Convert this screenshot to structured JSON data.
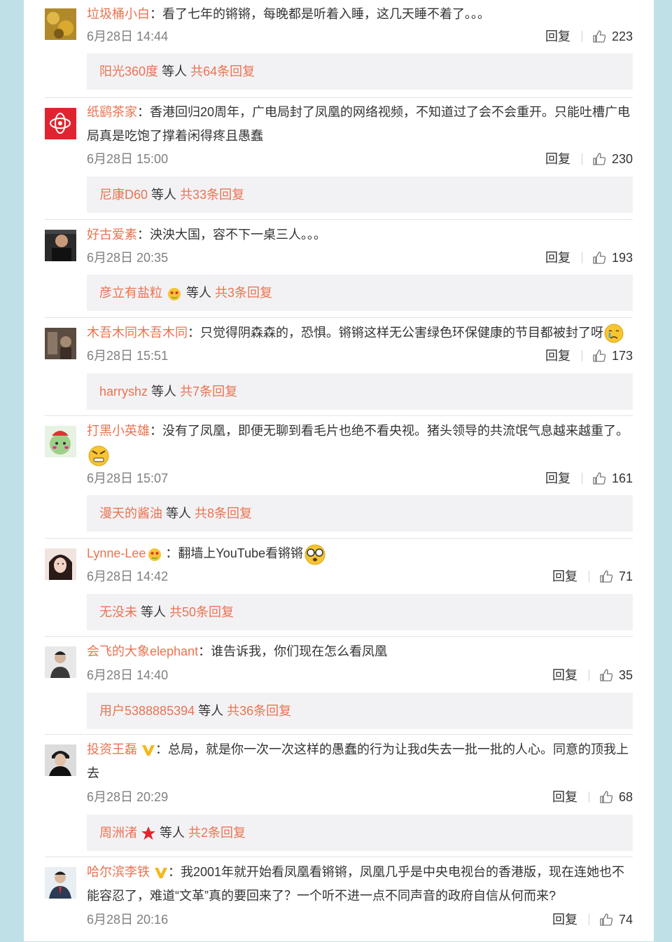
{
  "common": {
    "reply_label": "回复",
    "more_suffix": "等人",
    "colon": "："
  },
  "comments": [
    {
      "user": "垃圾桶小白",
      "text": "看了七年的锵锵，每晚都是听着入睡，这几天睡不着了。。。",
      "time": "6月28日 14:44",
      "likes": "223",
      "reply_user": "阳光360度",
      "reply_count": "共64条回复"
    },
    {
      "user": "纸鹞茶家",
      "text": "香港回归20周年，广电局封了凤凰的网络视频，不知道过了会不会重开。只能吐槽广电局真是吃饱了撑着闲得疼且愚蠢",
      "time": "6月28日 15:00",
      "likes": "230",
      "reply_user": "尼康D60",
      "reply_count": "共33条回复"
    },
    {
      "user": "好古爱素",
      "text": "泱泱大国，容不下一桌三人。。。",
      "time": "6月28日 20:35",
      "likes": "193",
      "reply_user": "彦立有盐粒",
      "reply_count": "共3条回复"
    },
    {
      "user": "木吾木同木吾木同",
      "text": "只觉得阴森森的，恐惧。锵锵这样无公害绿色环保健康的节目都被封了呀",
      "time": "6月28日 15:51",
      "likes": "173",
      "reply_user": "harryshz",
      "reply_count": "共7条回复"
    },
    {
      "user": "打黑小英雄",
      "text": "没有了凤凰，即便无聊到看毛片也绝不看央视。猪头领导的共流氓气息越来越重了。",
      "time": "6月28日 15:07",
      "likes": "161",
      "reply_user": "漫天的酱油",
      "reply_count": "共8条回复"
    },
    {
      "user": "Lynne-Lee",
      "text": "翻墙上YouTube看锵锵",
      "time": "6月28日 14:42",
      "likes": "71",
      "reply_user": "无没未",
      "reply_count": "共50条回复"
    },
    {
      "user": "会飞的大象elephant",
      "text": "谁告诉我，你们现在怎么看凤凰",
      "time": "6月28日 14:40",
      "likes": "35",
      "reply_user": "用户5388885394",
      "reply_count": "共36条回复"
    },
    {
      "user": "投资王磊",
      "text": "总局，就是你一次一次这样的愚蠢的行为让我d失去一批一批的人心。同意的顶我上去",
      "time": "6月28日 20:29",
      "likes": "68",
      "reply_user": "周洲渚",
      "reply_count": "共2条回复"
    },
    {
      "user": "哈尔滨李铁",
      "text": "我2001年就开始看凤凰看锵锵，凤凰几乎是中央电视台的香港版，现在连她也不能容忍了，难道“文革”真的要回来了？一个听不进一点不同声音的政府自信从何而来?",
      "time": "6月28日 20:16",
      "likes": "74"
    }
  ],
  "colors": {
    "username": "#eb7350",
    "text": "#333333",
    "meta": "#808080",
    "reply_box": "#f2f2f5",
    "page_bg": "#bfe0e6"
  }
}
